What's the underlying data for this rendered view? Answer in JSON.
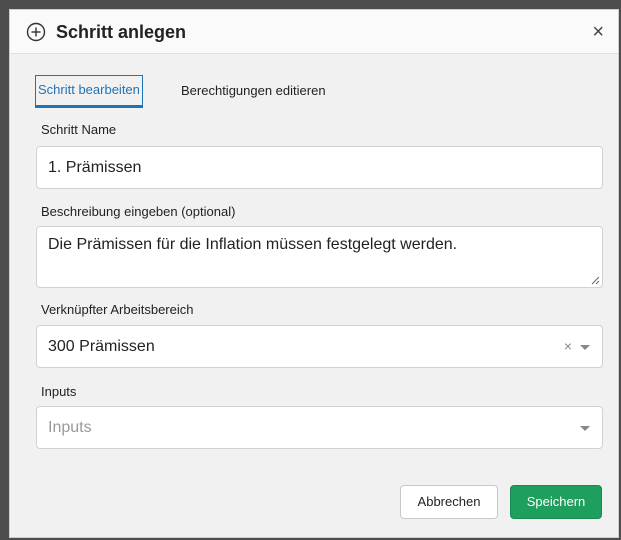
{
  "dialog": {
    "title": "Schritt anlegen",
    "close_label": "×"
  },
  "tabs": [
    {
      "label": "Schritt bearbeiten",
      "active": true
    },
    {
      "label": "Berechtigungen editieren",
      "active": false
    }
  ],
  "form": {
    "step_name": {
      "label": "Schritt Name",
      "value": "1. Prämissen"
    },
    "description": {
      "label": "Beschreibung eingeben (optional)",
      "value": "Die Prämissen für die Inflation müssen festgelegt werden."
    },
    "workspace": {
      "label": "Verknüpfter Arbeitsbereich",
      "value": "300 Prämissen",
      "clear_label": "×"
    },
    "inputs": {
      "label": "Inputs",
      "placeholder": "Inputs"
    }
  },
  "buttons": {
    "cancel_label": "Abbrechen",
    "save_label": "Speichern"
  },
  "colors": {
    "accent": "#1f73b7",
    "save": "#1e9f5d"
  }
}
